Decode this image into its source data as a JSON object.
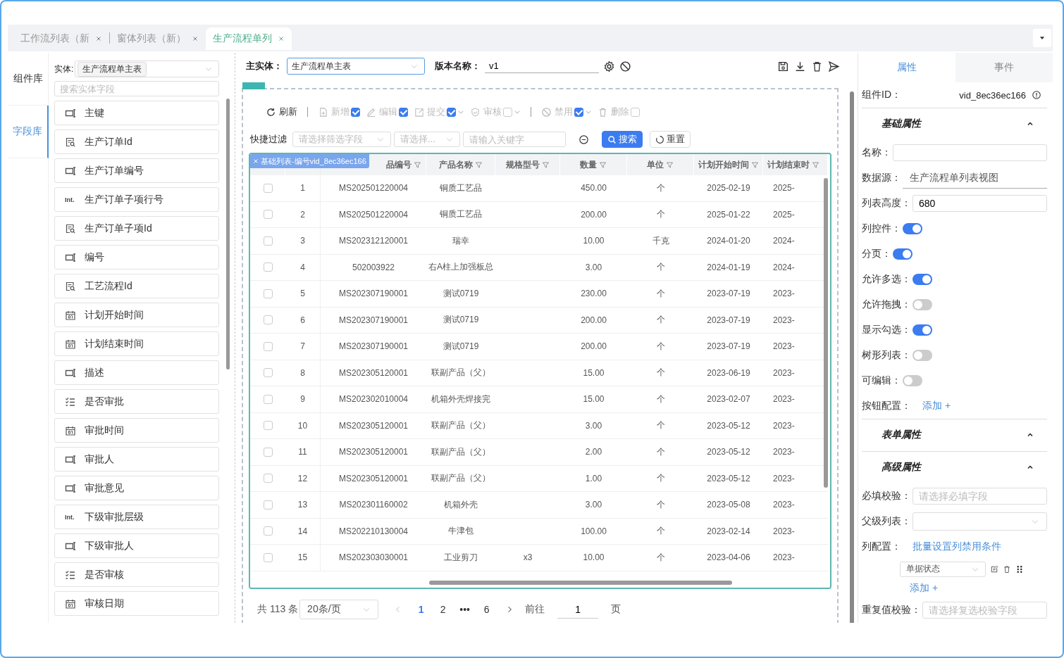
{
  "tabs": [
    {
      "label": "工作流列表（新",
      "selected": false
    },
    {
      "label": "窗体列表（新）",
      "selected": false
    },
    {
      "label": "生产流程单列",
      "selected": true
    }
  ],
  "left_nav": [
    {
      "label": "组件库",
      "selected": false
    },
    {
      "label": "字段库",
      "selected": true
    }
  ],
  "entity": {
    "label": "实体:",
    "value": "生产流程单主表"
  },
  "field_search": {
    "placeholder": "搜索实体字段"
  },
  "fields": [
    {
      "kind": "text",
      "label": "主键"
    },
    {
      "kind": "lookup",
      "label": "生产订单Id"
    },
    {
      "kind": "text",
      "label": "生产订单编号"
    },
    {
      "kind": "int",
      "icon_text": "Int.",
      "label": "生产订单子项行号"
    },
    {
      "kind": "lookup",
      "label": "生产订单子项Id"
    },
    {
      "kind": "text",
      "label": "编号"
    },
    {
      "kind": "lookup",
      "label": "工艺流程Id"
    },
    {
      "kind": "date",
      "label": "计划开始时间"
    },
    {
      "kind": "date",
      "label": "计划结束时间"
    },
    {
      "kind": "text",
      "label": "描述"
    },
    {
      "kind": "bool",
      "label": "是否审批"
    },
    {
      "kind": "date",
      "label": "审批时间"
    },
    {
      "kind": "text",
      "label": "审批人"
    },
    {
      "kind": "text",
      "label": "审批意见"
    },
    {
      "kind": "int",
      "icon_text": "Int.",
      "label": "下级审批层级"
    },
    {
      "kind": "text",
      "label": "下级审批人"
    },
    {
      "kind": "bool",
      "label": "是否审核"
    },
    {
      "kind": "date",
      "label": "审核日期"
    }
  ],
  "designer": {
    "main_entity_label": "主实体：",
    "main_entity": "生产流程单主表",
    "version_label": "版本名称：",
    "version": "v1"
  },
  "toolbar": [
    {
      "kind": "refresh",
      "label": "刷新"
    },
    {
      "kind": "divider"
    },
    {
      "kind": "add",
      "label": "新增",
      "checked": true,
      "dropdown": false
    },
    {
      "kind": "edit",
      "label": "编辑",
      "checked": true,
      "dropdown": false
    },
    {
      "kind": "submit",
      "label": "提交",
      "checked": true,
      "dropdown": true
    },
    {
      "kind": "review",
      "label": "审核",
      "checked": false,
      "dropdown": true
    },
    {
      "kind": "divider"
    },
    {
      "kind": "disable",
      "label": "禁用",
      "checked": true,
      "dropdown": true
    },
    {
      "kind": "delete",
      "label": "删除",
      "checked": false,
      "dropdown": false
    }
  ],
  "filter": {
    "label": "快捷过滤",
    "field_placeholder": "请选择筛选字段",
    "op_placeholder": "请选择...",
    "keyword_placeholder": "请输入关键字",
    "search": "搜索",
    "reset": "重置"
  },
  "table": {
    "overlay_label": "基础列表-编号vid_8ec36ec166",
    "columns": [
      "品编号",
      "产品名称",
      "规格型号",
      "数量",
      "单位",
      "计划开始时间",
      "计划结束时"
    ],
    "rows": [
      {
        "checked": false,
        "index": "1",
        "code": "MS202501220004",
        "name": "铜质工艺品",
        "qty": "450.00",
        "unit": "个",
        "start": "2025-02-19",
        "end": "2025-"
      },
      {
        "checked": false,
        "index": "2",
        "code": "MS202501220004",
        "name": "铜质工艺品",
        "qty": "200.00",
        "unit": "个",
        "start": "2025-01-22",
        "end": "2025-"
      },
      {
        "checked": false,
        "index": "3",
        "code": "MS202312120001",
        "name": "瑞幸",
        "qty": "10.00",
        "unit": "千克",
        "start": "2024-01-20",
        "end": "2024-"
      },
      {
        "checked": false,
        "index": "4",
        "code": "502003922",
        "name": "右A柱上加强板总",
        "qty": "3.00",
        "unit": "个",
        "start": "2024-01-19",
        "end": "2024-"
      },
      {
        "checked": false,
        "index": "5",
        "code": "MS202307190001",
        "name": "测试0719",
        "qty": "230.00",
        "unit": "个",
        "start": "2023-07-19",
        "end": "2023-"
      },
      {
        "checked": false,
        "index": "6",
        "code": "MS202307190001",
        "name": "测试0719",
        "qty": "200.00",
        "unit": "个",
        "start": "2023-07-19",
        "end": "2023-"
      },
      {
        "checked": false,
        "index": "7",
        "code": "MS202307190001",
        "name": "测试0719",
        "qty": "200.00",
        "unit": "个",
        "start": "2023-07-19",
        "end": "2023-"
      },
      {
        "checked": false,
        "index": "8",
        "code": "MS202305120001",
        "name": "联副产品（父）",
        "qty": "15.00",
        "unit": "个",
        "start": "2023-06-19",
        "end": "2023-"
      },
      {
        "checked": false,
        "index": "9",
        "code": "MS202302010004",
        "name": "机箱外壳焊接完",
        "qty": "15.00",
        "unit": "个",
        "start": "2023-02-07",
        "end": "2023-"
      },
      {
        "checked": false,
        "index": "10",
        "code": "MS202305120001",
        "name": "联副产品（父）",
        "qty": "3.00",
        "unit": "个",
        "start": "2023-05-12",
        "end": "2023-"
      },
      {
        "checked": false,
        "index": "11",
        "code": "MS202305120001",
        "name": "联副产品（父）",
        "qty": "2.00",
        "unit": "个",
        "start": "2023-05-12",
        "end": "2023-"
      },
      {
        "checked": false,
        "index": "12",
        "code": "MS202305120001",
        "name": "联副产品（父）",
        "qty": "1.00",
        "unit": "个",
        "start": "2023-05-12",
        "end": "2023-"
      },
      {
        "checked": false,
        "index": "13",
        "code": "MS202301160002",
        "name": "机箱外壳",
        "qty": "3.00",
        "unit": "个",
        "start": "2023-05-08",
        "end": "2023-"
      },
      {
        "checked": false,
        "index": "14",
        "code": "MS202210130004",
        "name": "牛津包",
        "qty": "100.00",
        "unit": "个",
        "start": "2023-02-14",
        "end": "2023-"
      },
      {
        "checked": false,
        "index": "15",
        "code": "MS202303030001",
        "name": "工业剪刀",
        "spec": "x3",
        "qty": "10.00",
        "unit": "个",
        "start": "2023-04-06",
        "end": "2023-"
      }
    ]
  },
  "pagination": {
    "total": "共 113 条",
    "page_size": "20条/页",
    "pages": [
      {
        "label": "1",
        "selected": true
      },
      {
        "label": "2",
        "selected": false
      },
      {
        "label": "•••",
        "selected": false
      },
      {
        "label": "6",
        "selected": false
      }
    ],
    "goto_label": "前往",
    "goto_value": "1",
    "page_unit": "页"
  },
  "properties": {
    "tabs": [
      {
        "label": "属性",
        "selected": true
      },
      {
        "label": "事件",
        "selected": false
      }
    ],
    "id_label": "组件ID：",
    "id_value": "vid_8ec36ec166",
    "sections": [
      {
        "title": "基础属性",
        "expanded": true,
        "rows": [
          {
            "kind": "input",
            "label": "名称："
          },
          {
            "kind": "readonly",
            "label": "数据源：",
            "value": "生产流程单列表视图"
          },
          {
            "kind": "input",
            "label": "列表高度：",
            "value": "680"
          },
          {
            "kind": "toggle",
            "label": "列控件：",
            "on": true
          },
          {
            "kind": "toggle",
            "label": "分页：",
            "on": true
          },
          {
            "kind": "toggle",
            "label": "允许多选：",
            "on": true
          },
          {
            "kind": "toggle",
            "label": "允许拖拽：",
            "on": false
          },
          {
            "kind": "toggle",
            "label": "显示勾选：",
            "on": true
          },
          {
            "kind": "toggle",
            "label": "树形列表：",
            "on": false
          },
          {
            "kind": "toggle",
            "label": "可编辑：",
            "on": false
          },
          {
            "kind": "link",
            "label": "按钮配置：",
            "link": "添加 +"
          }
        ]
      },
      {
        "title": "表单属性",
        "expanded": true
      },
      {
        "title": "高级属性",
        "expanded": true,
        "rows": [
          {
            "kind": "input",
            "label": "必填校验：",
            "placeholder": "请选择必填字段"
          },
          {
            "kind": "select",
            "label": "父级列表："
          },
          {
            "kind": "column_config",
            "label": "列配置：",
            "link": "批量设置列禁用条件",
            "item": "单据状态",
            "add": "添加 +"
          },
          {
            "kind": "input",
            "label": "重复值校验：",
            "placeholder": "请选择复选校验字段"
          }
        ]
      }
    ]
  }
}
